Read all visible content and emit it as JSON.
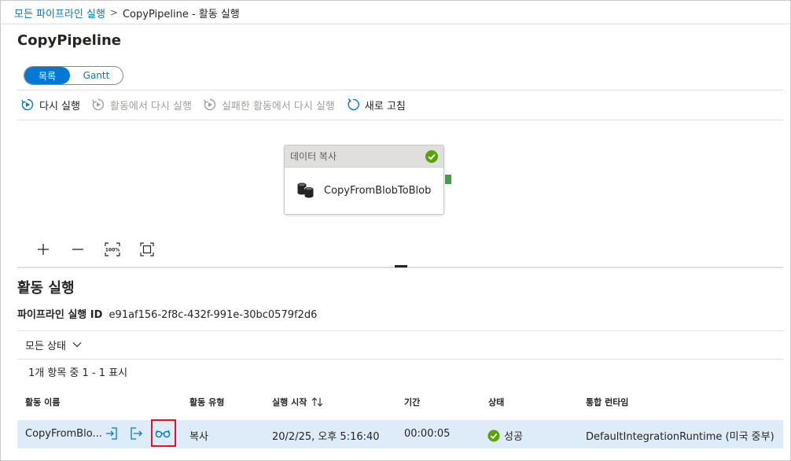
{
  "breadcrumb": {
    "parent": "모든 파이프라인 실행",
    "separator": ">",
    "current": "CopyPipeline - 활동 실행"
  },
  "page_title": "CopyPipeline",
  "view_toggle": {
    "list": "목록",
    "gantt": "Gantt",
    "selected": "목록"
  },
  "toolbar": {
    "rerun": "다시 실행",
    "rerun_from_activity": "활동에서 다시 실행",
    "rerun_from_failed": "실패한 활동에서 다시 실행",
    "refresh": "새로 고침"
  },
  "canvas": {
    "node": {
      "type": "데이터 복사",
      "name": "CopyFromBlobToBlob",
      "status": "succeeded",
      "icon": "database-icon"
    },
    "zoom_fit_label": "100%"
  },
  "activity_runs": {
    "title": "활동 실행",
    "run_id_label": "파이프라인 실행 ID",
    "run_id": "e91af156-2f8c-432f-991e-30bc0579f2d6",
    "filter": "모든 상태",
    "count": "1개 항목 중 1 - 1 표시",
    "columns": {
      "name": "활동 이름",
      "type": "활동 유형",
      "start": "실행 시작",
      "duration": "기간",
      "status": "상태",
      "runtime": "통합 런타임"
    },
    "rows": [
      {
        "name": "CopyFromBlo...",
        "type": "복사",
        "start": "20/2/25, 오후 5:16:40",
        "duration": "00:00:05",
        "status": "성공",
        "runtime": "DefaultIntegrationRuntime (미국 중부)"
      }
    ]
  },
  "colors": {
    "accent": "#0078d4",
    "success": "#57a300",
    "highlight": "#e81123",
    "row_selected": "#deecf9"
  }
}
